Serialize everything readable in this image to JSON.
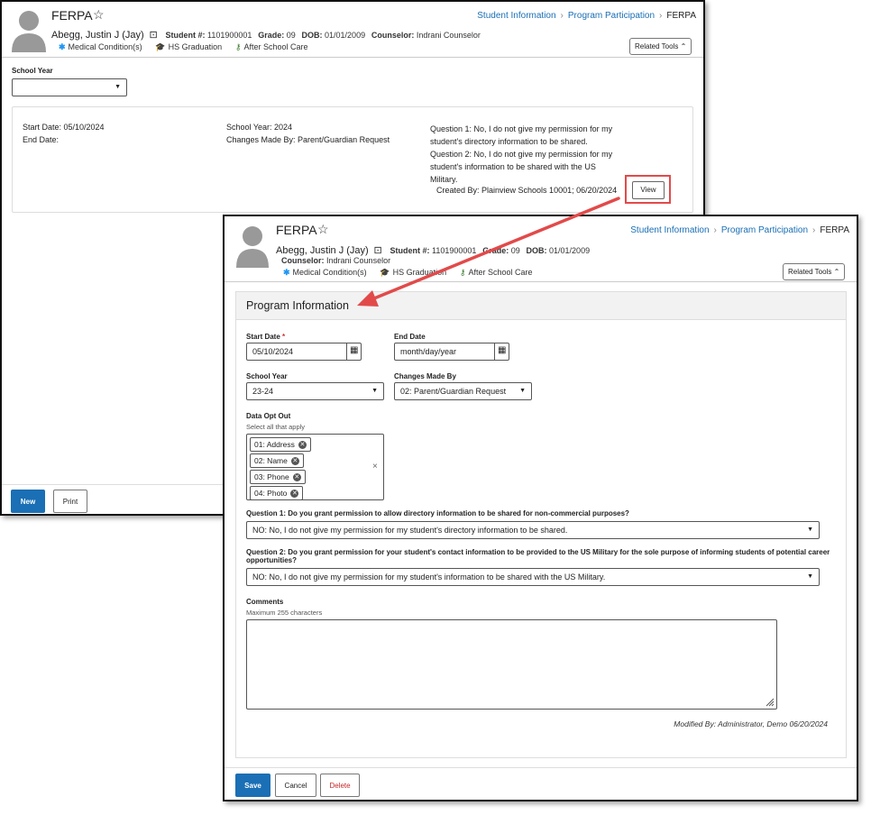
{
  "colors": {
    "link": "#1a6fb5",
    "primary_button": "#1a6fb5",
    "delete": "#c62828",
    "highlight_box": "#e24a4a",
    "arrow": "#e24a4a",
    "required": "#d32f2f"
  },
  "window1": {
    "title": "FERPA",
    "breadcrumb": [
      "Student Information",
      "Program Participation",
      "FERPA"
    ],
    "student_name": "Abegg, Justin J (Jay)",
    "student_num_label": "Student #:",
    "student_num": "1101900001",
    "grade_label": "Grade:",
    "grade": "09",
    "dob_label": "DOB:",
    "dob": "01/01/2009",
    "counselor_label": "Counselor:",
    "counselor": "Indrani Counselor",
    "flags": [
      {
        "icon": "asterisk-icon",
        "label": "Medical Condition(s)"
      },
      {
        "icon": "graduation-cap-icon",
        "label": "HS Graduation"
      },
      {
        "icon": "key-icon",
        "label": "After School Care"
      }
    ],
    "related_tools": "Related Tools",
    "school_year_label": "School Year",
    "school_year_value": "",
    "record": {
      "start_date": "Start Date: 05/10/2024",
      "end_date": "End Date:",
      "school_year": "School Year: 2024",
      "changes_made_by": "Changes Made By: Parent/Guardian Request",
      "q1_l1": "Question 1: No, I do not give my permission for my",
      "q1_l2": "student's directory information to be shared.",
      "q2_l1": "Question 2: No, I do not give my permission for my",
      "q2_l2": "student's information to be shared with the US",
      "q2_l3": "Military.",
      "created_by": "Created By: Plainview Schools 10001; 06/20/2024",
      "view_button": "View"
    },
    "new_button": "New",
    "print_button": "Print"
  },
  "window2": {
    "title": "FERPA",
    "breadcrumb": [
      "Student Information",
      "Program Participation",
      "FERPA"
    ],
    "student_name": "Abegg, Justin J (Jay)",
    "student_num_label": "Student #:",
    "student_num": "1101900001",
    "grade_label": "Grade:",
    "grade": "09",
    "dob_label": "DOB:",
    "dob": "01/01/2009",
    "counselor_label": "Counselor:",
    "counselor": "Indrani Counselor",
    "flags": [
      {
        "icon": "asterisk-icon",
        "label": "Medical Condition(s)"
      },
      {
        "icon": "graduation-cap-icon",
        "label": "HS Graduation"
      },
      {
        "icon": "key-icon",
        "label": "After School Care"
      }
    ],
    "related_tools": "Related Tools",
    "section_title": "Program Information",
    "start_date_label": "Start Date",
    "required_mark": "*",
    "start_date_value": "05/10/2024",
    "end_date_label": "End Date",
    "end_date_placeholder": "month/day/year",
    "school_year_label": "School Year",
    "school_year_value": "23-24",
    "changes_label": "Changes Made By",
    "changes_value": "02: Parent/Guardian Request",
    "opt_out_label": "Data Opt Out",
    "opt_out_sub": "Select all that apply",
    "opt_out_items": [
      "01: Address",
      "02: Name",
      "03: Phone",
      "04: Photo"
    ],
    "clear_icon": "×",
    "q1_label": "Question 1: Do you grant permission to allow directory information to be shared for non-commercial purposes?",
    "q1_value": "NO: No, I do not give my permission for my student's directory information to be shared.",
    "q2_label_l1": "Question 2: Do you grant permission for your student's contact information to be provided to the US Military for the sole purpose of informing students of potential career",
    "q2_label_l2": "opportunities?",
    "q2_value": "NO: No, I do not give my permission for my student's information to be shared with the US Military.",
    "comments_label": "Comments",
    "comments_sub": "Maximum 255 characters",
    "comments_value": "",
    "modified_by": "Modified By: Administrator, Demo 06/20/2024",
    "save_button": "Save",
    "cancel_button": "Cancel",
    "delete_button": "Delete"
  }
}
